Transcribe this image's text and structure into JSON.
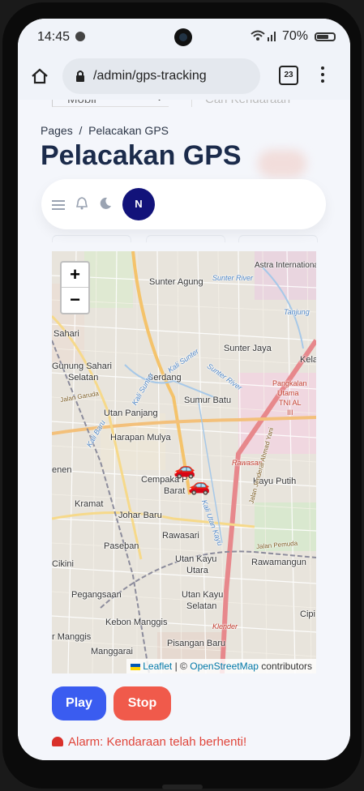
{
  "status_bar": {
    "time": "14:45",
    "battery": "70%",
    "battery_level": 0.7,
    "icons": [
      "spotify-icon",
      "wifi-icon",
      "signal-icon",
      "battery-icon"
    ]
  },
  "browser": {
    "url": "/admin/gps-tracking",
    "tab_count": "23"
  },
  "filters": {
    "vehicle_type": "Mobil",
    "search_placeholder": "Cari Kendaraan"
  },
  "breadcrumb": {
    "root": "Pages",
    "separator": "/",
    "current": "Pelacakan GPS"
  },
  "page_title": "Pelacakan GPS",
  "navbar": {
    "avatar_initial": "N"
  },
  "map": {
    "zoom_in": "+",
    "zoom_out": "−",
    "attribution": {
      "leaflet": "Leaflet",
      "separator": "| ©",
      "osm": "OpenStreetMap",
      "suffix": "contributors"
    },
    "labels": {
      "sunter_agung": "Sunter Agung",
      "astra": "Astra Internationa",
      "tanjung": "Tanjung",
      "sahari": "Sahari",
      "sunter_jaya": "Sunter Jaya",
      "gunung_sahari": "Gunung Sahari",
      "selatan": "Selatan",
      "kel": "Kela",
      "serdang": "Serdang",
      "pangkalan1": "Pangkalan",
      "pangkalan2": "Utama",
      "pangkalan3": "TNI AL",
      "pangkalan4": "III",
      "sumur_batu": "Sumur Batu",
      "utan_panjang": "Utan Panjang",
      "harapan_mulya": "Harapan Mulya",
      "rawasari_red": "Rawasari",
      "cempaka1": "Cempaka P",
      "cempaka2": "Barat",
      "kayu_putih": "Kayu Putih",
      "enen": "enen",
      "kramat": "Kramat",
      "johar_baru": "Johar Baru",
      "paseban": "Paseban",
      "rawasari": "Rawasari",
      "kini": "Cikini",
      "utan_kayu_utara1": "Utan Kayu",
      "utan_kayu_utara2": "Utara",
      "rawamangun": "Rawamangun",
      "pegangsaan": "Pegangsaan",
      "utan_kayu_selatan1": "Utan Kayu",
      "utan_kayu_selatan2": "Selatan",
      "cipi": "Cipi",
      "kebon_manggis": "Kebon Manggis",
      "manggis": "r Manggis",
      "klender": "Klender",
      "manggarai": "Manggarai",
      "pisangan_baru": "Pisangan Baru",
      "sunter_river": "Sunter River",
      "kali_sunter": "Kali Sunter",
      "kali_sunter2": "Kali Sunter",
      "kali_baru": "Kali Baru",
      "kali_utan": "Kali Utan Kayu",
      "jalan_garuda": "Jalan Garuda",
      "jalan_pemuda": "Jalan Pemuda",
      "jalan_ahmad": "Jalan Jenderal Ahmad Yani"
    }
  },
  "controls": {
    "play": "Play",
    "stop": "Stop"
  },
  "alarm": {
    "text": "Alarm: Kendaraan telah berhenti!"
  },
  "colors": {
    "play": "#3a5cf0",
    "stop": "#f05a4b",
    "alarm": "#e0453a",
    "title": "#1b2b4b",
    "avatar": "#12137a"
  }
}
